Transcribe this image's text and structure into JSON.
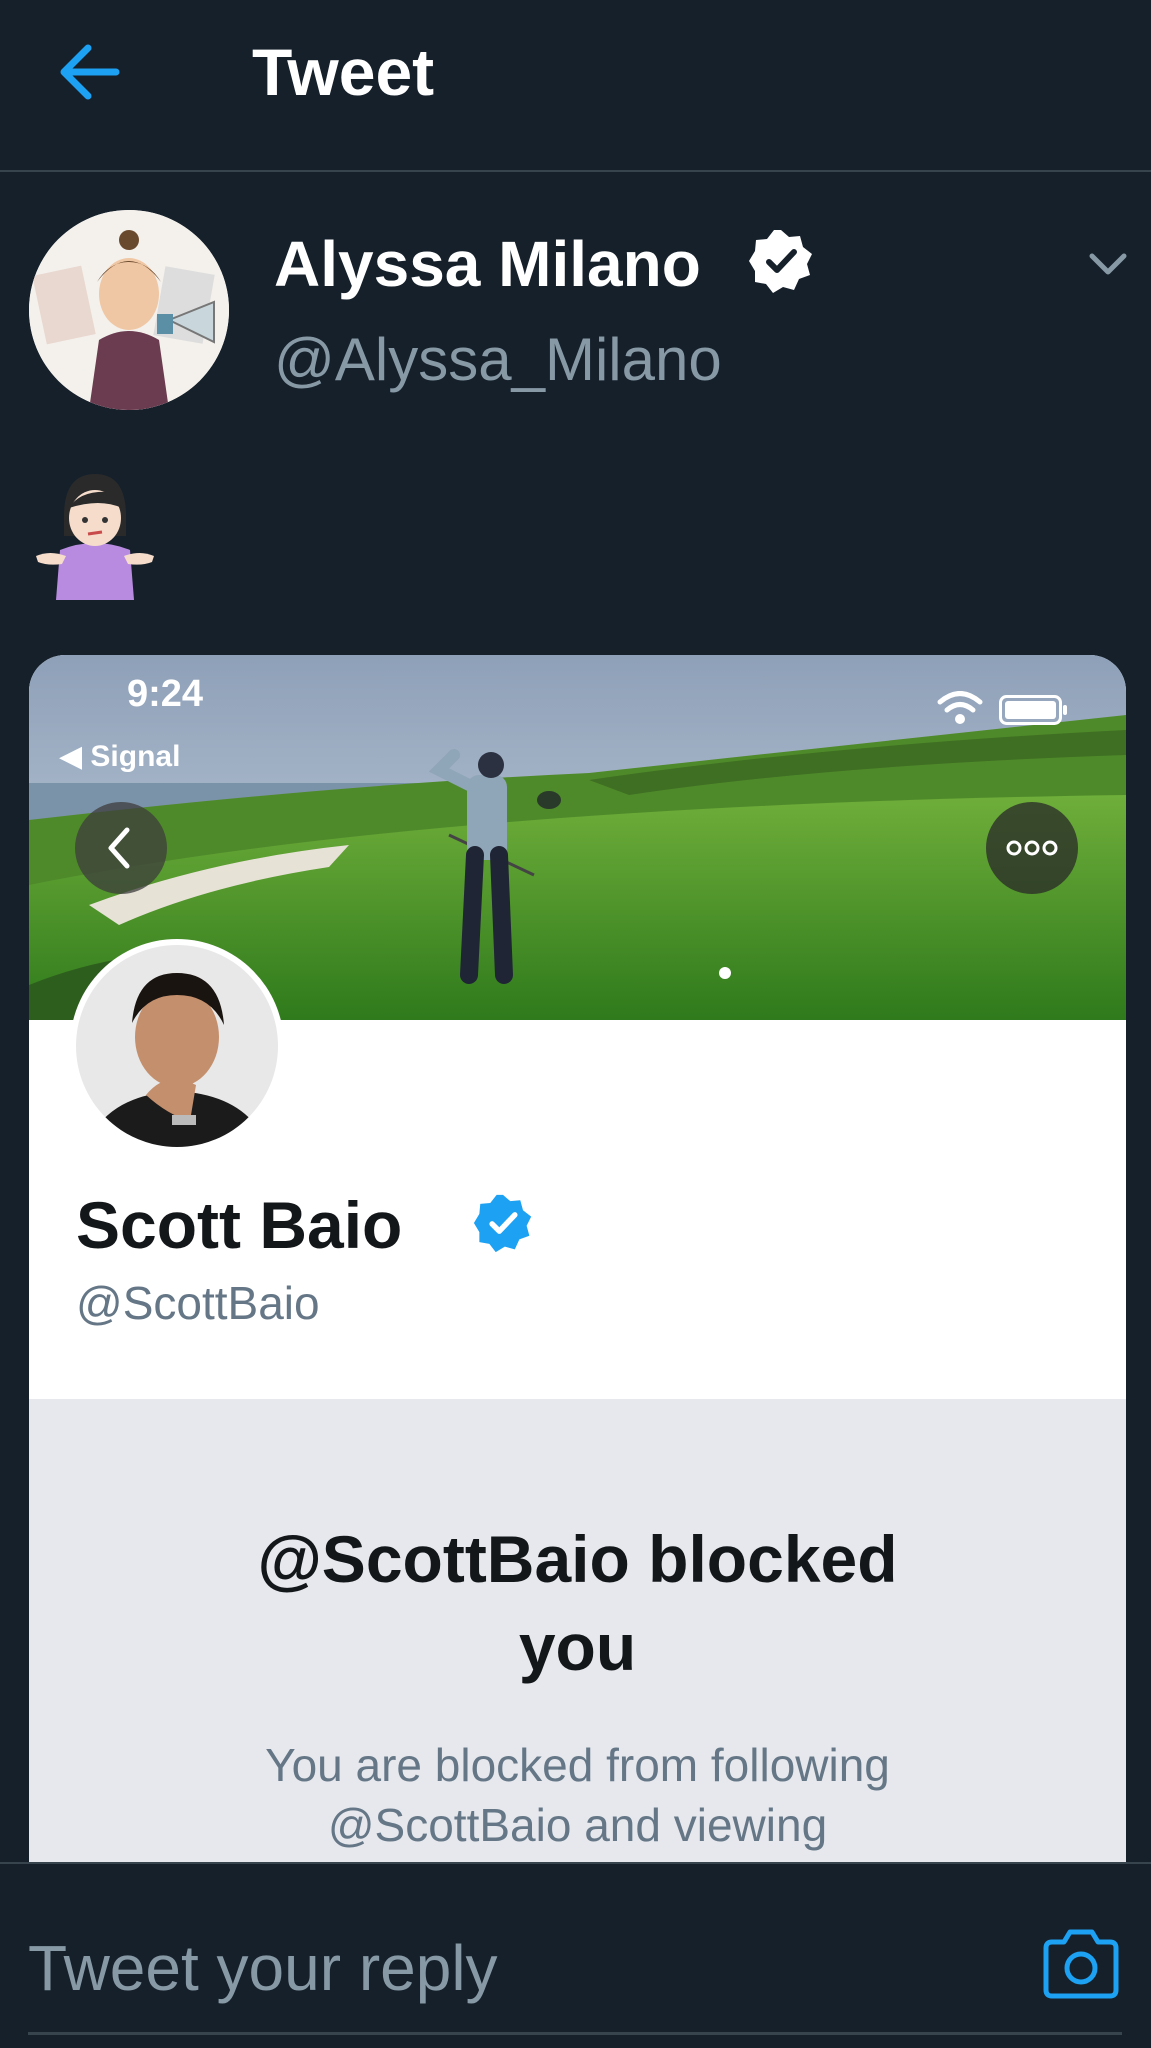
{
  "header": {
    "title": "Tweet",
    "back_icon": "arrow-left-icon"
  },
  "tweet": {
    "author_name": "Alyssa Milano",
    "author_handle": "@Alyssa_Milano",
    "verified": true,
    "menu_icon": "chevron-down-icon",
    "emoji": "🤷🏻‍♀️"
  },
  "screenshot": {
    "status_time": "9:24",
    "status_back_app": "◀ Signal",
    "profile_name": "Scott Baio",
    "profile_handle": "@ScottBaio",
    "blocked_title": "@ScottBaio blocked you",
    "blocked_description": "You are blocked from following @ScottBaio and viewing"
  },
  "reply": {
    "placeholder": "Tweet your reply",
    "camera_icon": "camera-icon"
  },
  "colors": {
    "background": "#15202b",
    "accent": "#1da1f2",
    "muted": "#8899a6"
  }
}
